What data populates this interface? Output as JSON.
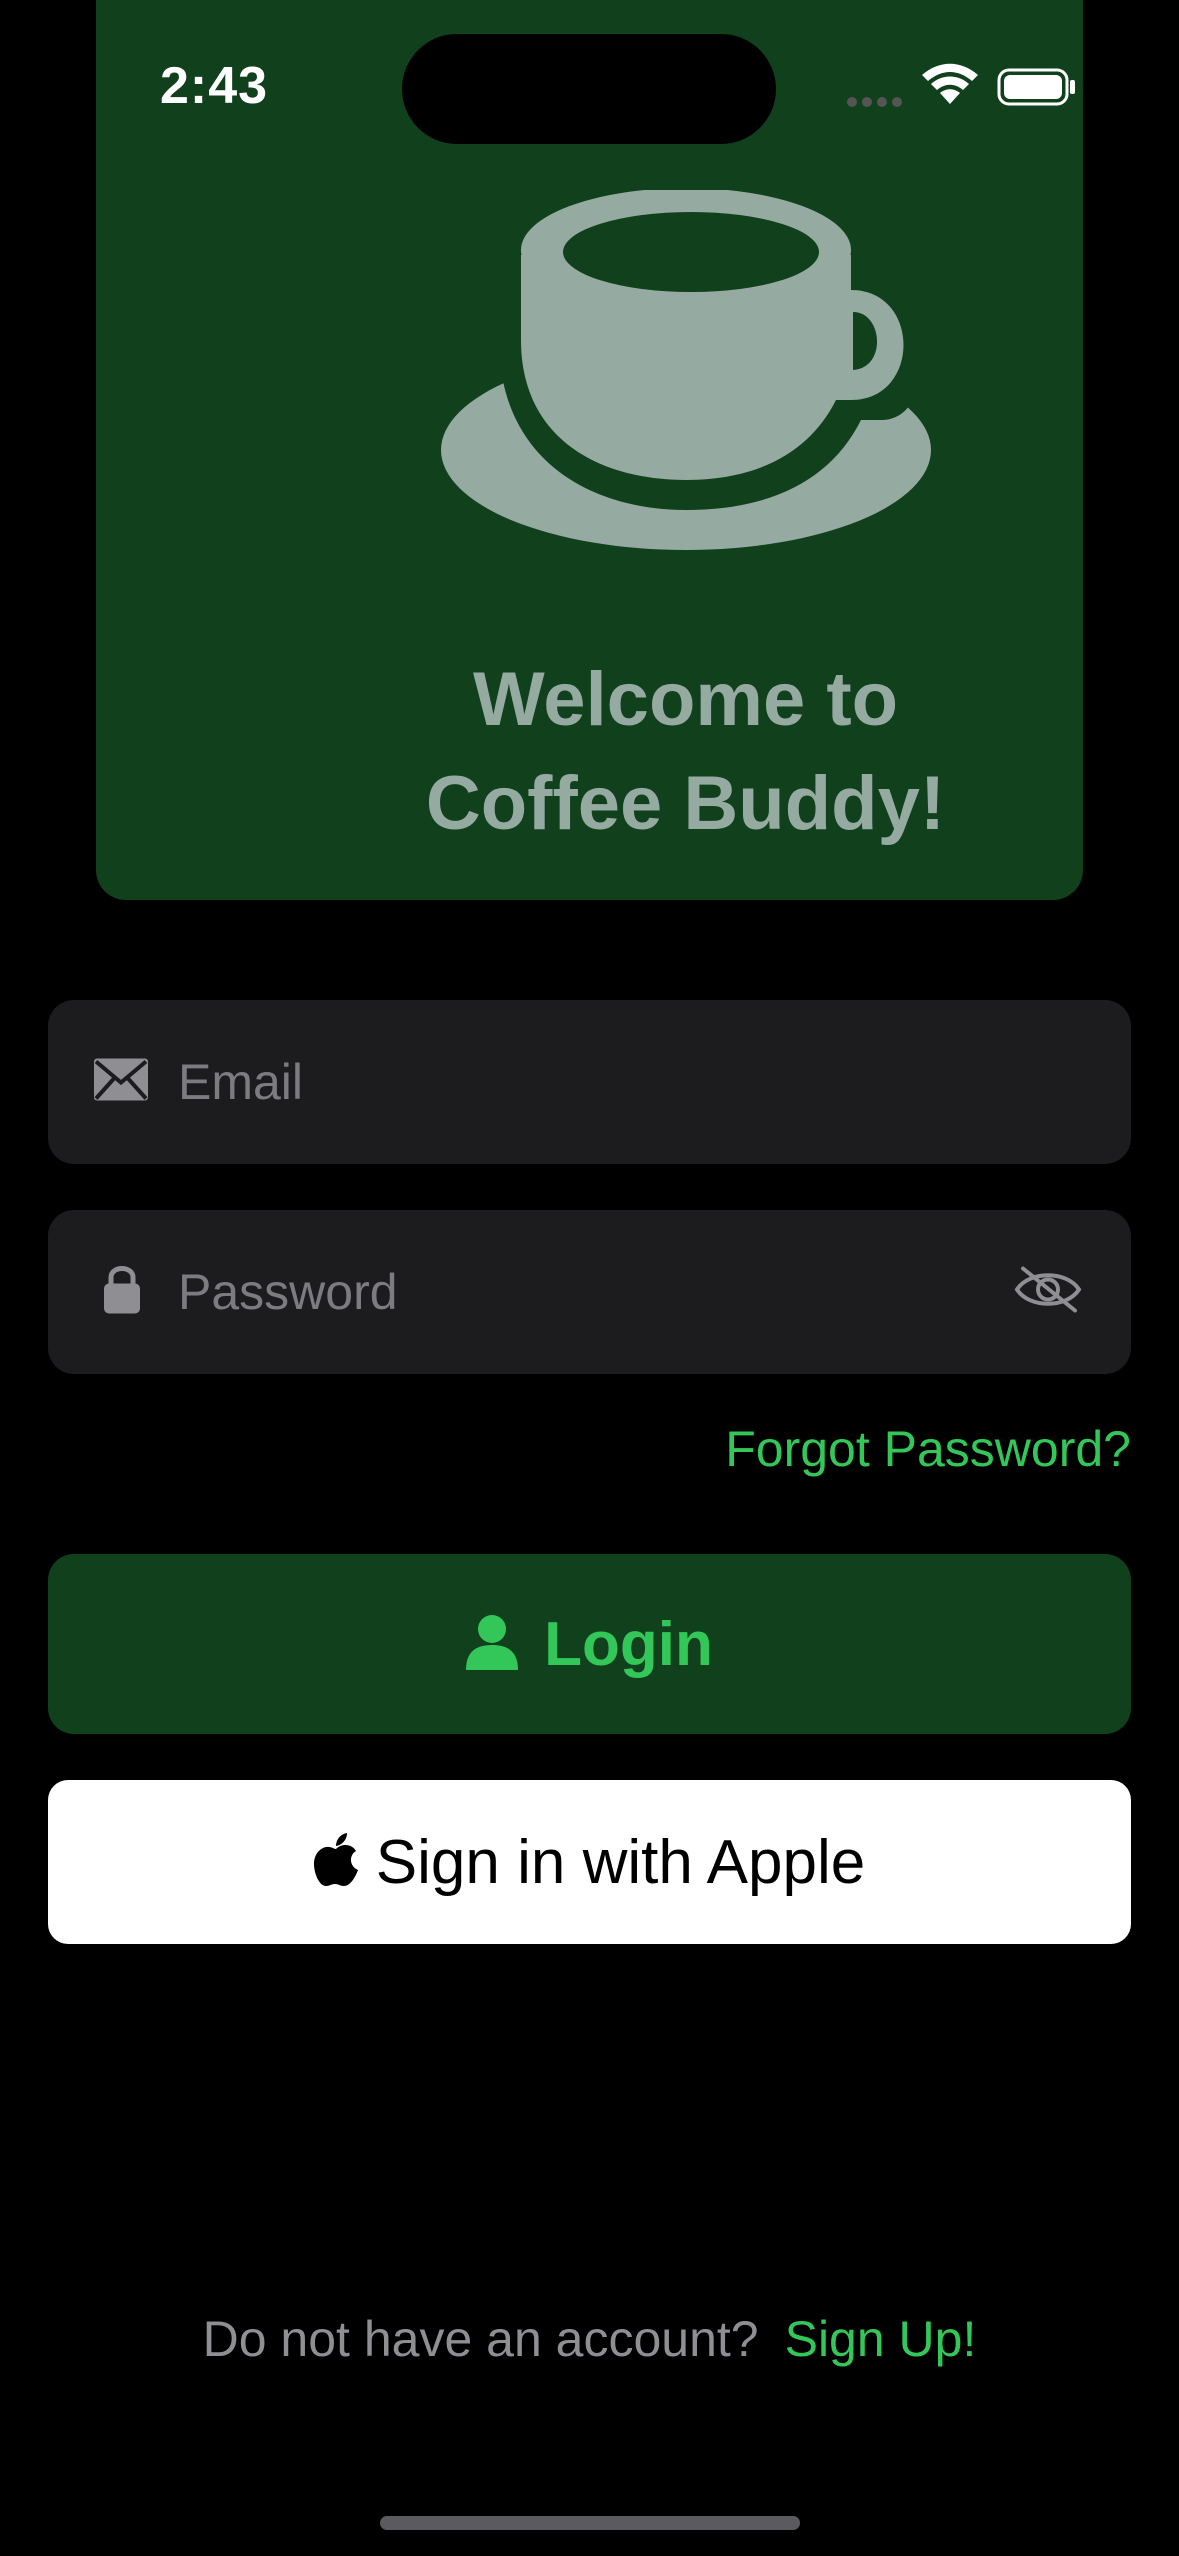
{
  "status_bar": {
    "time": "2:43"
  },
  "hero": {
    "icon": "coffee-cup-icon",
    "title_line1": "Welcome to",
    "title_line2": "Coffee Buddy!"
  },
  "form": {
    "email": {
      "placeholder": "Email",
      "value": "",
      "icon": "envelope-icon"
    },
    "password": {
      "placeholder": "Password",
      "value": "",
      "icon": "lock-icon",
      "toggle_icon": "eye-slash-icon"
    },
    "forgot_label": "Forgot Password?"
  },
  "buttons": {
    "login_label": "Login",
    "login_icon": "person-icon",
    "apple_label": "Sign in with Apple",
    "apple_icon": "apple-logo-icon"
  },
  "footer": {
    "prompt": "Do not have an account?",
    "signup_label": "Sign Up!"
  },
  "colors": {
    "background": "#000000",
    "hero_background": "#11401d",
    "hero_foreground": "#95aaa0",
    "accent": "#33c759",
    "field_background": "#1c1c1e",
    "placeholder": "#7b7b80"
  }
}
